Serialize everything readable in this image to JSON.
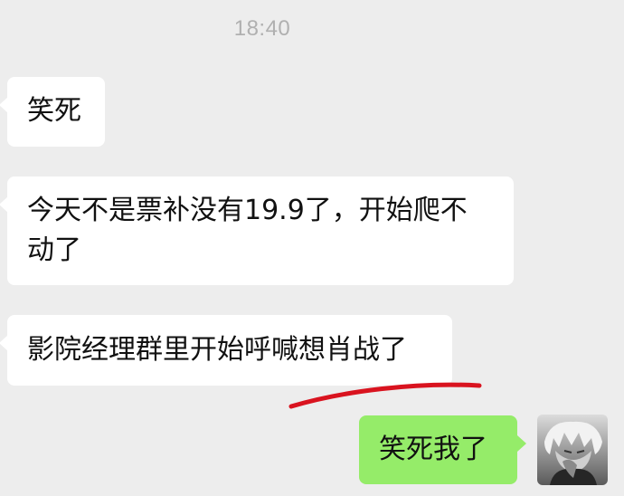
{
  "chat": {
    "timestamp": "18:40",
    "messages": [
      {
        "side": "incoming",
        "text": "笑死"
      },
      {
        "side": "incoming",
        "text": "今天不是票补没有19.9了，开始爬不动了"
      },
      {
        "side": "incoming",
        "text": "影院经理群里开始呼喊想肖战了"
      },
      {
        "side": "outgoing",
        "text": "笑死我了"
      }
    ]
  },
  "colors": {
    "background": "#ededed",
    "incoming_bubble": "#ffffff",
    "outgoing_bubble": "#95ec69",
    "annotation_stroke": "#d9131f"
  }
}
